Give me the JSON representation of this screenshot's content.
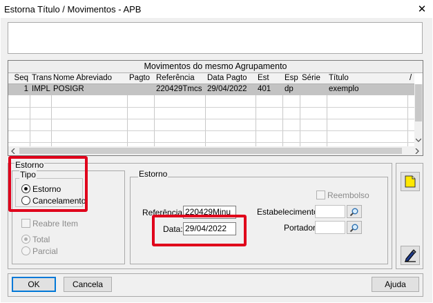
{
  "window": {
    "title": "Estorna Título / Movimentos  -  APB",
    "close_glyph": "✕"
  },
  "memo": {
    "value": ""
  },
  "grid": {
    "caption": "Movimentos do mesmo Agrupamento",
    "columns": [
      "Seq",
      "Trans",
      "Nome Abreviado",
      "Pagto",
      "Referência",
      "Data Pagto",
      "Est",
      "Esp",
      "Série",
      "Título",
      "/"
    ],
    "rows": [
      [
        "1",
        "IMPL",
        "POSIGR",
        "",
        "220429Tmcs",
        "29/04/2022",
        "401",
        "dp",
        "",
        "exemplo",
        ""
      ]
    ]
  },
  "estorno_left": {
    "group_label": "Estorno",
    "tipo": {
      "label": "Tipo",
      "options": [
        {
          "label": "Estorno",
          "selected": true
        },
        {
          "label": "Cancelamento",
          "selected": false
        }
      ]
    },
    "reabre_item": {
      "label": "Reabre Item",
      "checked": false
    },
    "scope_options": [
      {
        "label": "Total",
        "selected": true
      },
      {
        "label": "Parcial",
        "selected": false
      }
    ]
  },
  "estorno_right": {
    "group_label": "Estorno",
    "reembolso": {
      "label": "Reembolso",
      "checked": false
    },
    "referencia": {
      "label": "Referência:",
      "value": "220429Mjnu"
    },
    "data": {
      "label": "Data:",
      "value": "29/04/2022"
    },
    "estabelecimento": {
      "label": "Estabelecimento:",
      "value": ""
    },
    "portador": {
      "label": "Portador:",
      "value": ""
    }
  },
  "buttons": {
    "ok": "OK",
    "cancel": "Cancela",
    "help": "Ajuda"
  },
  "side_icons": [
    "note-icon",
    "edit-pen-icon"
  ],
  "colors": {
    "highlight": "#e0001b",
    "selected_row": "#c3c3c3",
    "note_yellow": "#ffe800"
  }
}
